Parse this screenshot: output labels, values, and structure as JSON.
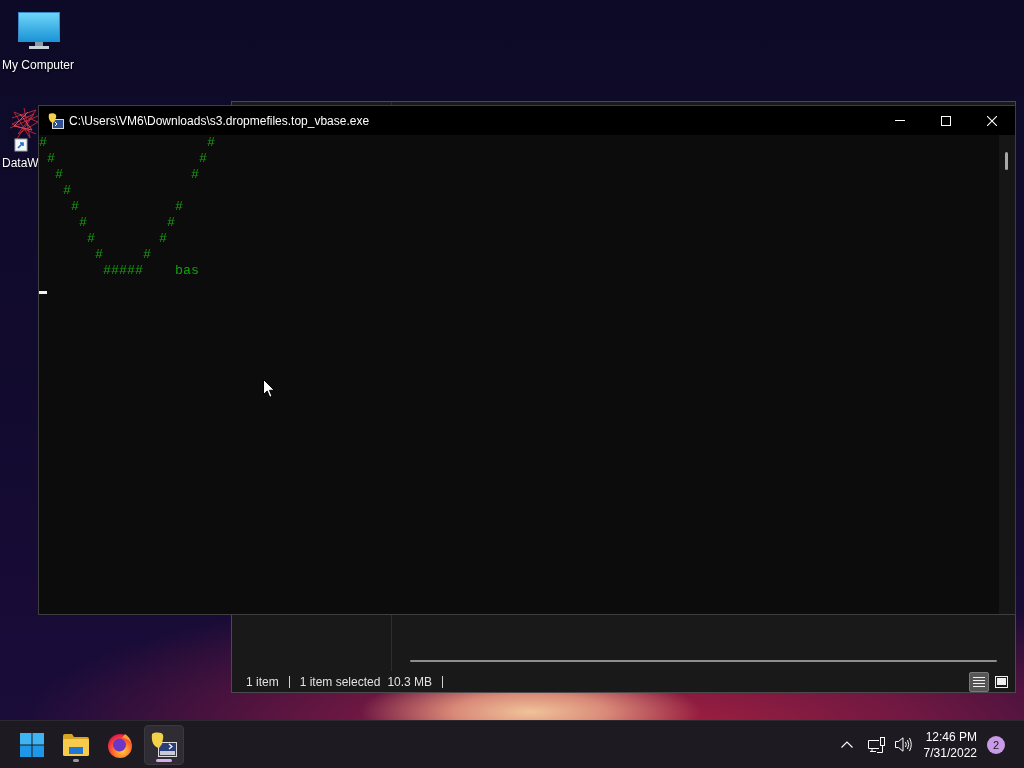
{
  "desktop": {
    "icons": [
      {
        "label": "My Computer"
      },
      {
        "label": "DataW"
      }
    ]
  },
  "explorer_window": {
    "status_bar": {
      "item_count": "1 item",
      "selection": "1 item selected",
      "size": "10.3 MB"
    },
    "view_buttons": [
      {
        "selected": true
      },
      {
        "selected": false
      }
    ]
  },
  "console_window": {
    "title": "C:\\Users\\VM6\\Downloads\\s3.dropmefiles.top_vbase.exe",
    "lines": [
      "#                    #",
      " #                  #",
      "  #                #",
      "   #",
      "    #            #",
      "     #          #",
      "      #        #",
      "       #     #",
      "        #####    bas"
    ]
  },
  "taskbar": {
    "apps": [
      {
        "running": true,
        "selected": false
      },
      {
        "running": false,
        "selected": false
      },
      {
        "running": true,
        "selected": true
      }
    ],
    "clock": {
      "time": "12:46 PM",
      "date": "7/31/2022"
    },
    "notification_count": "2"
  }
}
